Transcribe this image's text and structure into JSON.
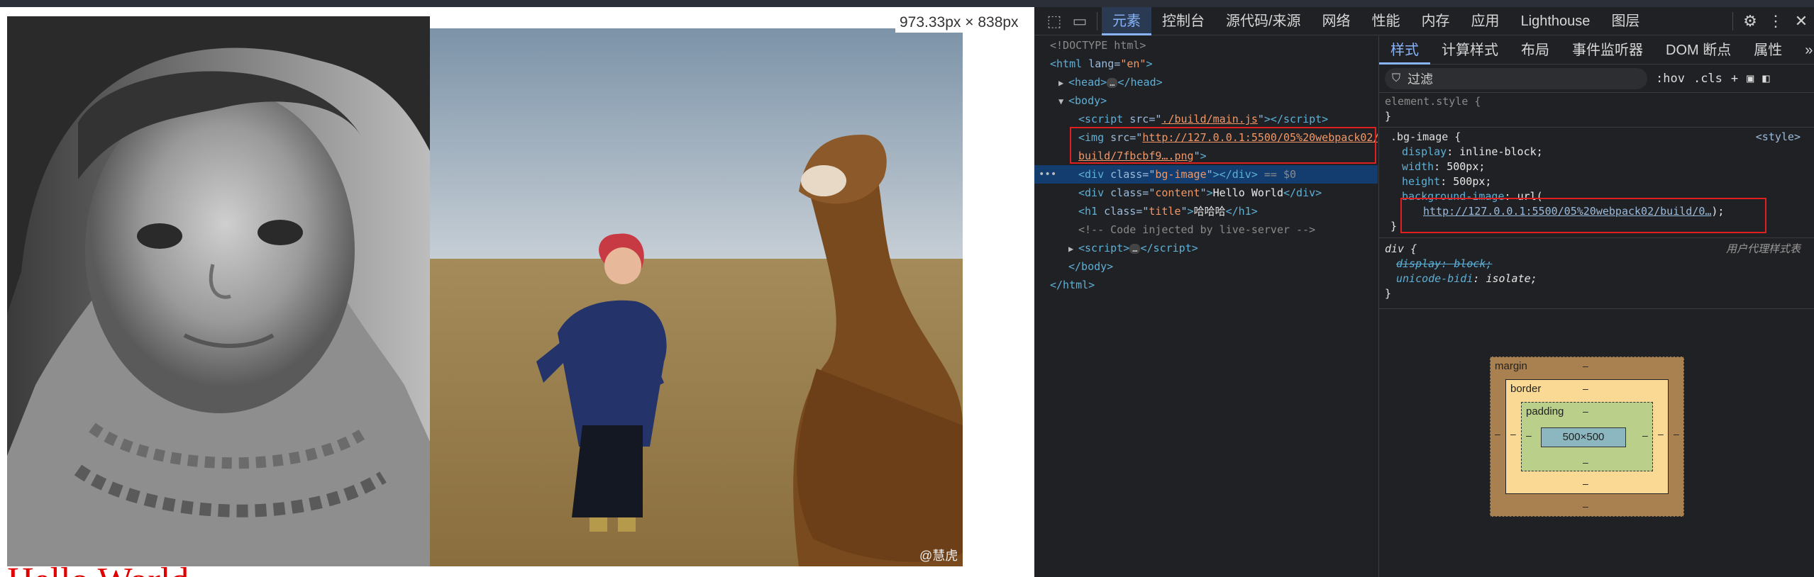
{
  "page": {
    "size_tooltip": "973.33px × 838px",
    "hello_text": "Hello World",
    "watermark": "@慧虎"
  },
  "devtools": {
    "tabs": [
      "元素",
      "控制台",
      "源代码/来源",
      "网络",
      "性能",
      "内存",
      "应用",
      "Lighthouse",
      "图层"
    ],
    "active_tab": "元素",
    "dom": {
      "doctype": "<!DOCTYPE html>",
      "html_open_tag": "html",
      "html_lang_attr": "lang",
      "html_lang_val": "\"en\"",
      "head_tag": "head",
      "body_tag": "body",
      "script_src_attr": "src",
      "script_src_val": "./build/main.js",
      "img_src_line1": "http://127.0.0.1:5500/05%20webpack02/",
      "img_src_line2": "build/7fbcbf9….png",
      "div_bg_class": "bg-image",
      "selected_marker": "== $0",
      "div_content_class": "content",
      "div_content_text": "Hello World",
      "h1_class": "title",
      "h1_text": "哈哈哈",
      "comment": "<!-- Code injected by live-server -->",
      "script_tag": "script",
      "body_close": "</body>",
      "html_close": "</html>"
    },
    "styles": {
      "tabs": [
        "样式",
        "计算样式",
        "布局",
        "事件监听器",
        "DOM 断点",
        "属性"
      ],
      "active_tab": "样式",
      "filter_placeholder": "过滤",
      "hov": ":hov",
      "cls": ".cls",
      "element_style": "element.style {",
      "rule_selector": ".bg-image {",
      "rule_source": "<style>",
      "props": [
        {
          "name": "display",
          "value": "inline-block;"
        },
        {
          "name": "width",
          "value": "500px;"
        },
        {
          "name": "height",
          "value": "500px;"
        }
      ],
      "bg_prop": "background-image",
      "bg_url_fn": "url(",
      "bg_url": "http://127.0.0.1:5500/05%20webpack02/build/0…",
      "bg_url_end": ");",
      "close_brace": "}",
      "ua_selector": "div {",
      "ua_source": "用户代理样式表",
      "ua_props": [
        {
          "name": "display",
          "value": "block;",
          "struck": true
        },
        {
          "name": "unicode-bidi",
          "value": "isolate;",
          "struck": false
        }
      ]
    },
    "box_model": {
      "margin_label": "margin",
      "border_label": "border",
      "padding_label": "padding",
      "content": "500×500",
      "dash": "–"
    }
  },
  "colors": {
    "devtools_bg": "#202124",
    "accent": "#8ab4f8",
    "highlight_box": "#e02020",
    "hello_text": "#e00000",
    "margin": "#a9804f",
    "border": "#f9d993",
    "padding": "#b9cf8a",
    "content": "#8cb6c0"
  }
}
